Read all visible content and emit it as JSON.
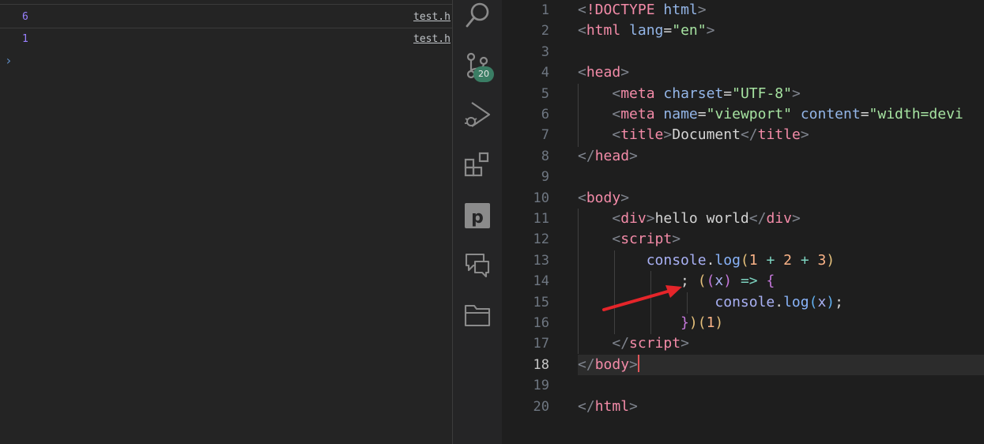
{
  "console": {
    "rows": [
      {
        "value": "6",
        "source": "test.h"
      },
      {
        "value": "1",
        "source": "test.h"
      }
    ],
    "prompt_glyph": "›"
  },
  "activity_bar": {
    "items": [
      {
        "name": "search-icon"
      },
      {
        "name": "source-control-icon",
        "badge": "20"
      },
      {
        "name": "run-debug-icon"
      },
      {
        "name": "extensions-icon"
      },
      {
        "name": "p-extension-icon",
        "label": "p"
      },
      {
        "name": "comments-icon"
      },
      {
        "name": "folder-icon"
      }
    ]
  },
  "editor": {
    "line_numbers": [
      "1",
      "2",
      "3",
      "4",
      "5",
      "6",
      "7",
      "8",
      "9",
      "10",
      "11",
      "12",
      "13",
      "14",
      "15",
      "16",
      "17",
      "18",
      "19",
      "20"
    ],
    "active_line": "18",
    "tokens": {
      "doctype": "!DOCTYPE",
      "html_kw": "html",
      "html_tag": "html",
      "lang_attr": "lang",
      "lang_val": "\"en\"",
      "head_tag": "head",
      "meta_tag": "meta",
      "charset_attr": "charset",
      "charset_val": "\"UTF-8\"",
      "name_attr": "name",
      "viewport_val": "\"viewport\"",
      "content_attr": "content",
      "content_val": "\"width=devi",
      "title_tag": "title",
      "title_text": "Document",
      "body_tag": "body",
      "div_tag": "div",
      "div_text": "hello world",
      "script_tag": "script",
      "console": "console",
      "log": "log",
      "num1": "1",
      "num2": "2",
      "num3": "3",
      "plus": "+",
      "semicolon": ";",
      "param": "x",
      "arrow_op": "=>",
      "iife_arg": "1"
    }
  },
  "colors": {
    "annotation_arrow": "#e5252a",
    "badge": "#3a7d64",
    "console_value": "#9980ff"
  }
}
